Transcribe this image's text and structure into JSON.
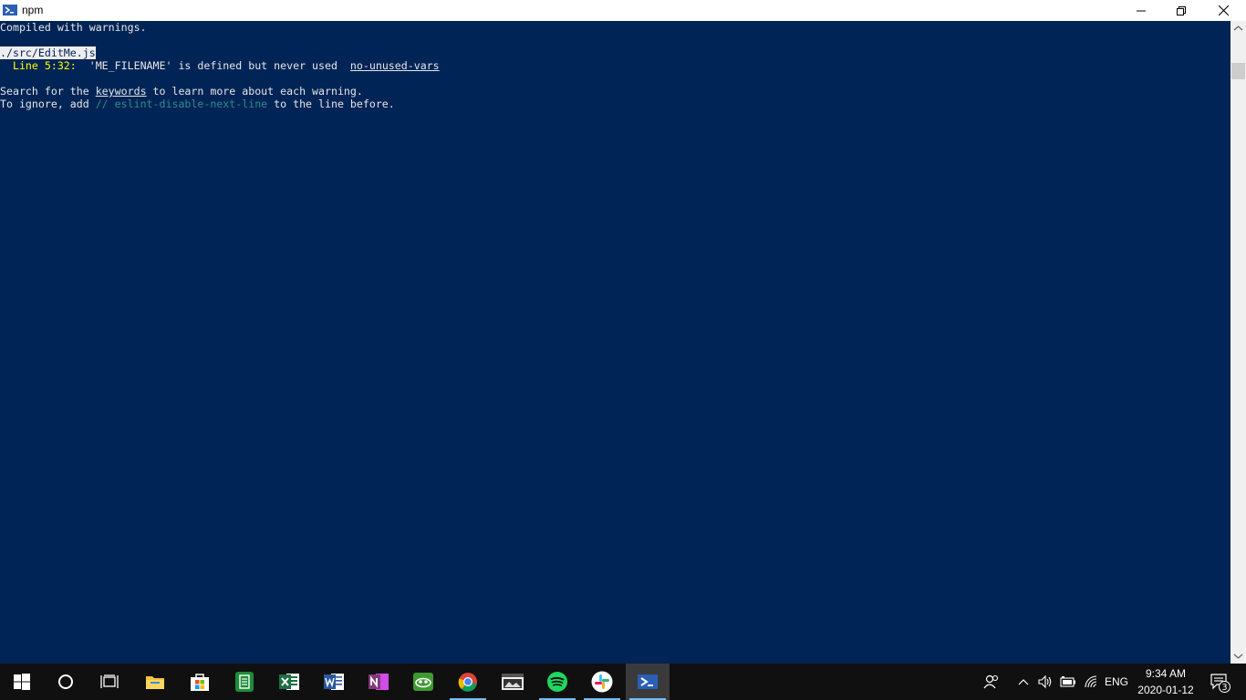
{
  "window": {
    "title": "npm"
  },
  "console": {
    "line1": "Compiled with warnings.",
    "file": "./src/EditMe.js",
    "warn_loc": "  Line 5:32:",
    "warn_msg": "  'ME_FILENAME' is defined but never used  ",
    "warn_rule": "no-unused-vars",
    "search_a": "Search for the ",
    "search_kw": "keywords",
    "search_b": " to learn more about each warning.",
    "ignore_a": "To ignore, add ",
    "ignore_comment": "// eslint-disable-next-line",
    "ignore_b": " to the line before."
  },
  "taskbar": {
    "apps": [
      "start-icon",
      "cortana-search-icon",
      "task-view-icon",
      "file-explorer-icon",
      "microsoft-store-icon",
      "notepad-icon",
      "excel-icon",
      "word-icon",
      "onenote-icon",
      "cloud-app-icon",
      "chrome-icon",
      "photos-icon",
      "spotify-icon",
      "slack-icon",
      "powershell-icon"
    ],
    "tray": {
      "language": "ENG",
      "time": "9:34 AM",
      "date": "2020-01-12",
      "notification_count": "3"
    }
  },
  "colors": {
    "console_bg": "#012456",
    "console_fg": "#e6e6e6",
    "warning_yellow": "#ffff00",
    "comment_teal": "#2d8c8a",
    "taskbar_bg": "#101010",
    "accent": "#76b9ed"
  }
}
